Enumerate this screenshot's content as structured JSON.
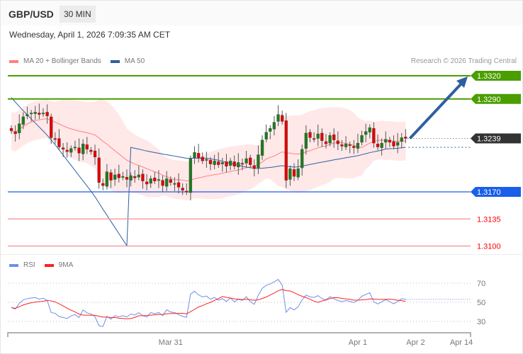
{
  "header": {
    "pair": "GBP/USD",
    "timeframe": "30 MIN",
    "datetime": "Wednesday, April 1, 2026 7:09:35 AM CET"
  },
  "legend": {
    "ma20": "MA 20 + Bollinger Bands",
    "ma50": "MA 50",
    "rsi": "RSI",
    "rsi_ma": "9MA"
  },
  "credit": "Research © 2026 Trading Central",
  "colors": {
    "resistance": "#4a9e00",
    "pivot": "#1a5eea",
    "support": "#ff0000",
    "support_line": "#f4a0a0",
    "last": "#333333",
    "up": "#1f7a1f",
    "down": "#e00000",
    "ma20": "#ff8080",
    "ma50": "#2f5f9f",
    "band": "#ffe4e4",
    "rsi": "#6f8fe6",
    "rsi_ma": "#ff2020",
    "arrow": "#2f5f9f"
  },
  "levels": [
    {
      "label": "1.3320",
      "value": 1.332,
      "type": "resistance"
    },
    {
      "label": "1.3290",
      "value": 1.329,
      "type": "resistance"
    },
    {
      "label": "1.3239",
      "value": 1.3239,
      "type": "last"
    },
    {
      "label": "1.3170",
      "value": 1.317,
      "type": "pivot"
    },
    {
      "label": "1.3135",
      "value": 1.3135,
      "type": "support"
    },
    {
      "label": "1.3100",
      "value": 1.31,
      "type": "support"
    }
  ],
  "x_labels": [
    {
      "label": "Mar 31",
      "index": 40
    },
    {
      "label": "Apr 1",
      "index": 87
    },
    {
      "label": "Apr 2",
      "index": 101.5
    },
    {
      "label": "Apr 14",
      "index": 113
    }
  ],
  "rsi_ticks": [
    {
      "label": "70",
      "value": 70
    },
    {
      "label": "50",
      "value": 50
    },
    {
      "label": "30",
      "value": 30
    }
  ],
  "chart_data": {
    "type": "candlestick",
    "price_range": [
      1.3085,
      1.3335
    ],
    "target": 1.332,
    "closes": [
      1.3249,
      1.3245,
      1.3258,
      1.3267,
      1.327,
      1.3272,
      1.3273,
      1.327,
      1.3272,
      1.3268,
      1.324,
      1.3238,
      1.3228,
      1.3225,
      1.3222,
      1.3226,
      1.3228,
      1.322,
      1.3232,
      1.3225,
      1.3222,
      1.3215,
      1.3182,
      1.3178,
      1.3196,
      1.3185,
      1.3192,
      1.3188,
      1.319,
      1.3186,
      1.3191,
      1.3188,
      1.3192,
      1.3184,
      1.318,
      1.3187,
      1.3184,
      1.3186,
      1.3178,
      1.3187,
      1.3182,
      1.3181,
      1.3176,
      1.3172,
      1.317,
      1.3213,
      1.3221,
      1.3214,
      1.321,
      1.3212,
      1.3206,
      1.321,
      1.3205,
      1.3208,
      1.3203,
      1.321,
      1.3203,
      1.3208,
      1.3206,
      1.3213,
      1.3205,
      1.32,
      1.3218,
      1.3237,
      1.3247,
      1.3252,
      1.326,
      1.327,
      1.3261,
      1.3185,
      1.32,
      1.319,
      1.32,
      1.3225,
      1.3246,
      1.324,
      1.3238,
      1.3245,
      1.3236,
      1.3232,
      1.3243,
      1.3237,
      1.3232,
      1.3229,
      1.3232,
      1.323,
      1.3227,
      1.3233,
      1.3243,
      1.3248,
      1.3253,
      1.3233,
      1.3228,
      1.3233,
      1.3238,
      1.3234,
      1.3229,
      1.3234,
      1.324,
      1.3239
    ]
  }
}
